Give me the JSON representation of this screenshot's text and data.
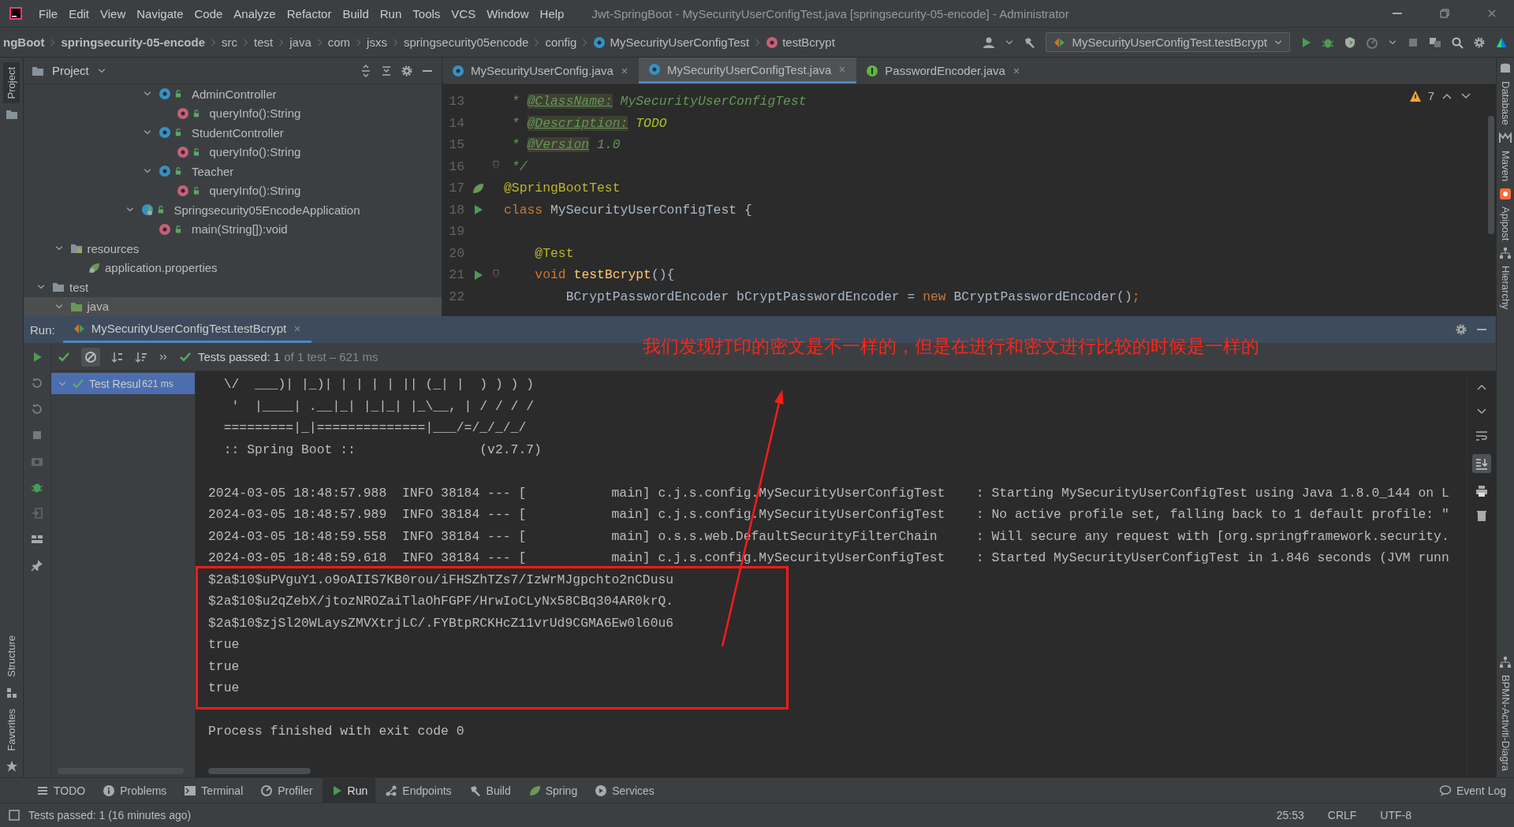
{
  "menu": [
    "File",
    "Edit",
    "View",
    "Navigate",
    "Code",
    "Analyze",
    "Refactor",
    "Build",
    "Run",
    "Tools",
    "VCS",
    "Window",
    "Help"
  ],
  "window_title": "Jwt-SpringBoot - MySecurityUserConfigTest.java [springsecurity-05-encode] - Administrator",
  "breadcrumbs": [
    {
      "label": "ngBoot",
      "kind": "project"
    },
    {
      "label": "springsecurity-05-encode",
      "kind": "module"
    },
    {
      "label": "src",
      "kind": "dir"
    },
    {
      "label": "test",
      "kind": "dir"
    },
    {
      "label": "java",
      "kind": "dir"
    },
    {
      "label": "com",
      "kind": "dir"
    },
    {
      "label": "jsxs",
      "kind": "dir"
    },
    {
      "label": "springsecurity05encode",
      "kind": "dir"
    },
    {
      "label": "config",
      "kind": "dir"
    },
    {
      "label": "MySecurityUserConfigTest",
      "kind": "class"
    },
    {
      "label": "testBcrypt",
      "kind": "method"
    }
  ],
  "run_config": "MySecurityUserConfigTest.testBcrypt",
  "left_stripe": [
    {
      "label": "Project",
      "selected": true
    },
    {
      "label": "Structure",
      "selected": false
    },
    {
      "label": "Favorites",
      "selected": false
    }
  ],
  "right_stripe": [
    "Database",
    "Maven",
    "Apipost",
    "Hierarchy",
    "BPMN-Activiti-Diagra"
  ],
  "project_panel": {
    "title": "Project",
    "tree": [
      {
        "label": "AdminController",
        "kind": "class",
        "expanded": true,
        "selected": false,
        "children": [
          {
            "label": "queryInfo():String",
            "kind": "method",
            "selected": false
          }
        ]
      },
      {
        "label": "StudentController",
        "kind": "class",
        "expanded": true,
        "selected": false,
        "children": [
          {
            "label": "queryInfo():String",
            "kind": "method",
            "selected": false
          }
        ]
      },
      {
        "label": "Teacher",
        "kind": "class",
        "expanded": true,
        "selected": false,
        "children": [
          {
            "label": "queryInfo():String",
            "kind": "method",
            "selected": false
          }
        ]
      },
      {
        "label": "Springsecurity05EncodeApplication",
        "kind": "app",
        "expanded": true,
        "selected": false,
        "children": [
          {
            "label": "main(String[]):void",
            "kind": "method",
            "selected": false
          }
        ]
      },
      {
        "label": "resources",
        "kind": "resources",
        "expanded": true,
        "selected": false,
        "children": [
          {
            "label": "application.properties",
            "kind": "properties",
            "selected": false
          }
        ]
      },
      {
        "label": "test",
        "kind": "folder",
        "expanded": true,
        "selected": false,
        "children": [
          {
            "label": "java",
            "kind": "source",
            "expanded": true,
            "selected": true
          }
        ]
      }
    ]
  },
  "editor_tabs": [
    {
      "label": "MySecurityUserConfig.java",
      "kind": "class",
      "selected": false
    },
    {
      "label": "MySecurityUserConfigTest.java",
      "kind": "class",
      "selected": true
    },
    {
      "label": "PasswordEncoder.java",
      "kind": "interface",
      "selected": false
    }
  ],
  "editor": {
    "warnings": "7",
    "lines": [
      {
        "number": "13",
        "kind": "plain",
        "fold": false,
        "tokens": [
          {
            "text": " * ",
            "kind": "comment"
          },
          {
            "text": "@ClassName:",
            "kind": "doctag"
          },
          {
            "text": " MySecurityUserConfigTest",
            "kind": "comment"
          }
        ]
      },
      {
        "number": "14",
        "kind": "plain",
        "fold": false,
        "tokens": [
          {
            "text": " * ",
            "kind": "comment"
          },
          {
            "text": "@Description:",
            "kind": "doctag"
          },
          {
            "text": " TODO",
            "kind": "todo"
          }
        ]
      },
      {
        "number": "15",
        "kind": "plain",
        "fold": false,
        "tokens": [
          {
            "text": " * ",
            "kind": "comment"
          },
          {
            "text": "@Version",
            "kind": "doctag"
          },
          {
            "text": " 1.0",
            "kind": "comment"
          }
        ]
      },
      {
        "number": "16",
        "kind": "plain",
        "fold": true,
        "tokens": [
          {
            "text": " */",
            "kind": "comment"
          }
        ]
      },
      {
        "number": "17",
        "kind": "spring",
        "fold": false,
        "tokens": [
          {
            "text": "@SpringBootTest",
            "kind": "annotation"
          }
        ]
      },
      {
        "number": "18",
        "kind": "runnable",
        "fold": false,
        "tokens": [
          {
            "text": "class",
            "kind": "keyword"
          },
          {
            "text": " MySecurityUserConfigTest {",
            "kind": "plain"
          }
        ]
      },
      {
        "number": "19",
        "kind": "plain",
        "fold": false
      },
      {
        "number": "20",
        "kind": "plain",
        "fold": false,
        "tokens": [
          {
            "text": "    @Test",
            "kind": "annotation"
          }
        ]
      },
      {
        "number": "21",
        "kind": "runnable",
        "fold": true,
        "tokens": [
          {
            "text": "    void",
            "kind": "keyword"
          },
          {
            "text": " testBcrypt",
            "kind": "method"
          },
          {
            "text": "(){",
            "kind": "plain"
          }
        ]
      },
      {
        "number": "22",
        "kind": "plain",
        "fold": false,
        "tokens": [
          {
            "text": "        BCryptPasswordEncoder bCryptPasswordEncoder = ",
            "kind": "plain"
          },
          {
            "text": "new",
            "kind": "keyword"
          },
          {
            "text": " BCryptPasswordEncoder()",
            "kind": "plain"
          },
          {
            "text": ";",
            "kind": "keyword"
          }
        ]
      }
    ]
  },
  "run_panel": {
    "label": "Run:",
    "tab": "MySecurityUserConfigTest.testBcrypt",
    "status": "Tests passed: 1",
    "status_detail": "of 1 test – 621 ms",
    "test_result": {
      "label": "Test Resul",
      "time": "621 ms",
      "selected": true
    },
    "banner": [
      "  \\/  ___)| |_)| | | | | || (_| |  ) ) ) )",
      "   '  |____| .__|_| |_|_| |_\\__, | / / / /",
      "  =========|_|==============|___/=/_/_/_/",
      "  :: Spring Boot ::                (v2.7.7)"
    ],
    "log": [
      "2024-03-05 18:48:57.988  INFO 38184 --- [           main] c.j.s.config.MySecurityUserConfigTest    : Starting MySecurityUserConfigTest using Java 1.8.0_144 on L",
      "2024-03-05 18:48:57.989  INFO 38184 --- [           main] c.j.s.config.MySecurityUserConfigTest    : No active profile set, falling back to 1 default profile: \"",
      "2024-03-05 18:48:59.558  INFO 38184 --- [           main] o.s.s.web.DefaultSecurityFilterChain     : Will secure any request with [org.springframework.security.",
      "2024-03-05 18:48:59.618  INFO 38184 --- [           main] c.j.s.config.MySecurityUserConfigTest    : Started MySecurityUserConfigTest in 1.846 seconds (JVM runn"
    ],
    "output": [
      "$2a$10$uPVguY1.o9oAIIS7KB0rou/iFHSZhTZs7/IzWrMJgpchto2nCDusu",
      "$2a$10$u2qZebX/jtozNROZaiTlaOhFGPF/HrwIoCLyNx58CBq304AR0krQ.",
      "$2a$10$zjSl20WLaysZMVXtrjLC/.FYBtpRCKHcZ11vrUd9CGMA6Ew0l60u6",
      "true",
      "true",
      "true"
    ],
    "exit": "Process finished with exit code 0"
  },
  "annotation": "我们发现打印的密文是不一样的，但是在进行和密文进行比较的时候是一样的",
  "bottom_tabs": [
    {
      "label": "TODO",
      "kind": "list",
      "selected": false
    },
    {
      "label": "Problems",
      "kind": "info",
      "selected": false
    },
    {
      "label": "Terminal",
      "kind": "terminal",
      "selected": false
    },
    {
      "label": "Profiler",
      "kind": "profiler",
      "selected": false
    },
    {
      "label": "Run",
      "kind": "run",
      "selected": true
    },
    {
      "label": "Endpoints",
      "kind": "endpoints",
      "selected": false
    },
    {
      "label": "Build",
      "kind": "hammer",
      "selected": false
    },
    {
      "label": "Spring",
      "kind": "leaf",
      "selected": false
    },
    {
      "label": "Services",
      "kind": "services",
      "selected": false
    }
  ],
  "event_log": "Event Log",
  "status_bar": {
    "message": "Tests passed: 1 (16 minutes ago)",
    "items": [
      "25:53",
      "CRLF",
      "UTF-8"
    ]
  }
}
